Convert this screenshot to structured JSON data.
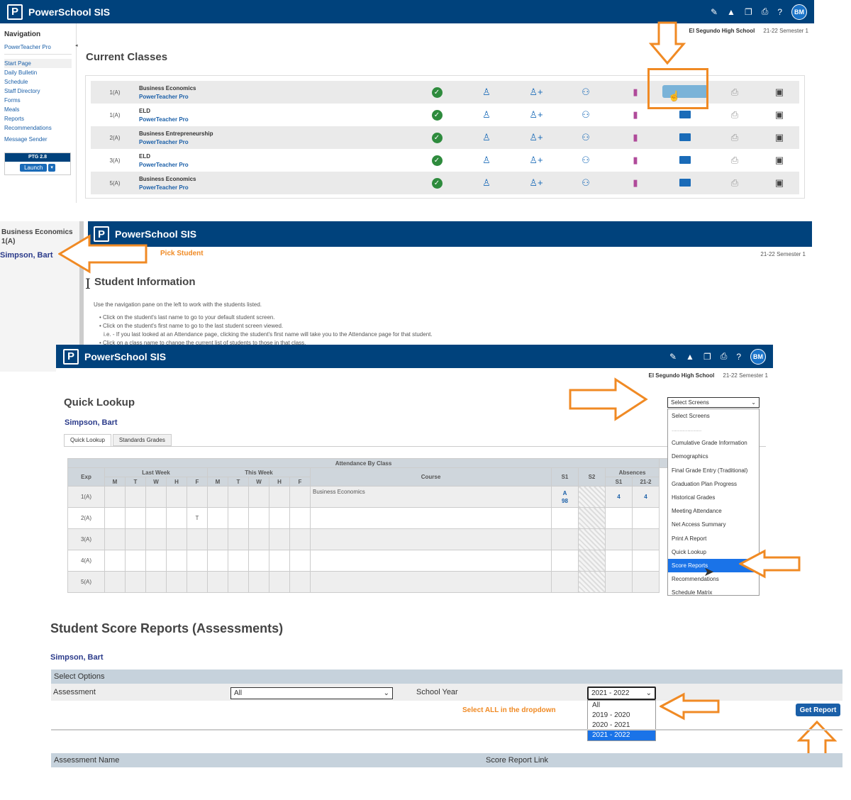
{
  "app": {
    "title": "PowerSchool SIS",
    "avatar": "BM",
    "school": "El Segundo High School",
    "term": "21-22 Semester 1"
  },
  "p1": {
    "nav": {
      "title": "Navigation",
      "ptp": "PowerTeacher Pro",
      "items": [
        "Start Page",
        "Daily Bulletin",
        "Schedule",
        "Staff Directory",
        "Forms",
        "Meals",
        "Reports",
        "Recommendations",
        "Message Sender"
      ],
      "ptg_label": "PTG 2.8",
      "launch": "Launch"
    },
    "page_title": "Current Classes",
    "classes": [
      {
        "exp": "1(A)",
        "name": "Business Economics",
        "link": "PowerTeacher Pro"
      },
      {
        "exp": "1(A)",
        "name": "ELD",
        "link": "PowerTeacher Pro"
      },
      {
        "exp": "2(A)",
        "name": "Business Entrepreneurship",
        "link": "PowerTeacher Pro"
      },
      {
        "exp": "3(A)",
        "name": "ELD",
        "link": "PowerTeacher Pro"
      },
      {
        "exp": "5(A)",
        "name": "Business Economics",
        "link": "PowerTeacher Pro"
      }
    ]
  },
  "p2": {
    "class_name": "Business Economics",
    "class_exp": "1(A)",
    "student": "Simpson, Bart",
    "annotation": "Pick Student",
    "page_title": "Student Information",
    "intro": "Use the navigation pane on the left to work with the students listed.",
    "bullets": [
      "Click on the student's last name to go to your default student screen.",
      "Click on the student's first name to go to the last student screen viewed.",
      "i.e. - If you last looked at an Attendance page, clicking the student's first name will take you to the Attendance page for that student.",
      "Click on a class name to change the current list of students to those in that class."
    ]
  },
  "p3": {
    "page_title": "Quick Lookup",
    "student": "Simpson, Bart",
    "tabs": [
      "Quick Lookup",
      "Standards Grades"
    ],
    "select_value": "Select Screens",
    "dropdown": [
      "Select Screens",
      "...................",
      "Cumulative Grade Information",
      "Demographics",
      "Final Grade Entry (Traditional)",
      "Graduation Plan Progress",
      "Historical Grades",
      "Meeting Attendance",
      "Net Access Summary",
      "Print A Report",
      "Quick Lookup",
      "Score Reports",
      "Recommendations",
      "Schedule Matrix"
    ],
    "table": {
      "title": "Attendance By Class",
      "exp": "Exp",
      "last_week": "Last Week",
      "this_week": "This Week",
      "days": [
        "M",
        "T",
        "W",
        "H",
        "F",
        "M",
        "T",
        "W",
        "H",
        "F"
      ],
      "course": "Course",
      "s1": "S1",
      "s2": "S2",
      "absences": "Absences",
      "abs_s1": "S1",
      "abs_yr": "21-2",
      "rows": [
        {
          "exp": "1(A)",
          "mark": "",
          "course": "Business Economics",
          "s1a": "A",
          "s1b": "98",
          "abs1": "4",
          "abs2": "4"
        },
        {
          "exp": "2(A)",
          "mark": "T",
          "course": "",
          "s1a": "",
          "s1b": "",
          "abs1": "",
          "abs2": ""
        },
        {
          "exp": "3(A)",
          "mark": "",
          "course": "",
          "s1a": "",
          "s1b": "",
          "abs1": "",
          "abs2": ""
        },
        {
          "exp": "4(A)",
          "mark": "",
          "course": "",
          "s1a": "",
          "s1b": "",
          "abs1": "",
          "abs2": ""
        },
        {
          "exp": "5(A)",
          "mark": "",
          "course": "",
          "s1a": "",
          "s1b": "",
          "abs1": "",
          "abs2": ""
        }
      ]
    }
  },
  "p4": {
    "page_title": "Student Score Reports (Assessments)",
    "student": "Simpson, Bart",
    "section": "Select Options",
    "assessment_label": "Assessment",
    "assessment_value": "All",
    "year_label": "School Year",
    "year_value": "2021 - 2022",
    "year_options": [
      "All",
      "2019 - 2020",
      "2020 - 2021",
      "2021 - 2022"
    ],
    "annotation": "Select ALL in the dropdown",
    "button": "Get Report",
    "col1": "Assessment Name",
    "col2": "Score Report Link"
  }
}
